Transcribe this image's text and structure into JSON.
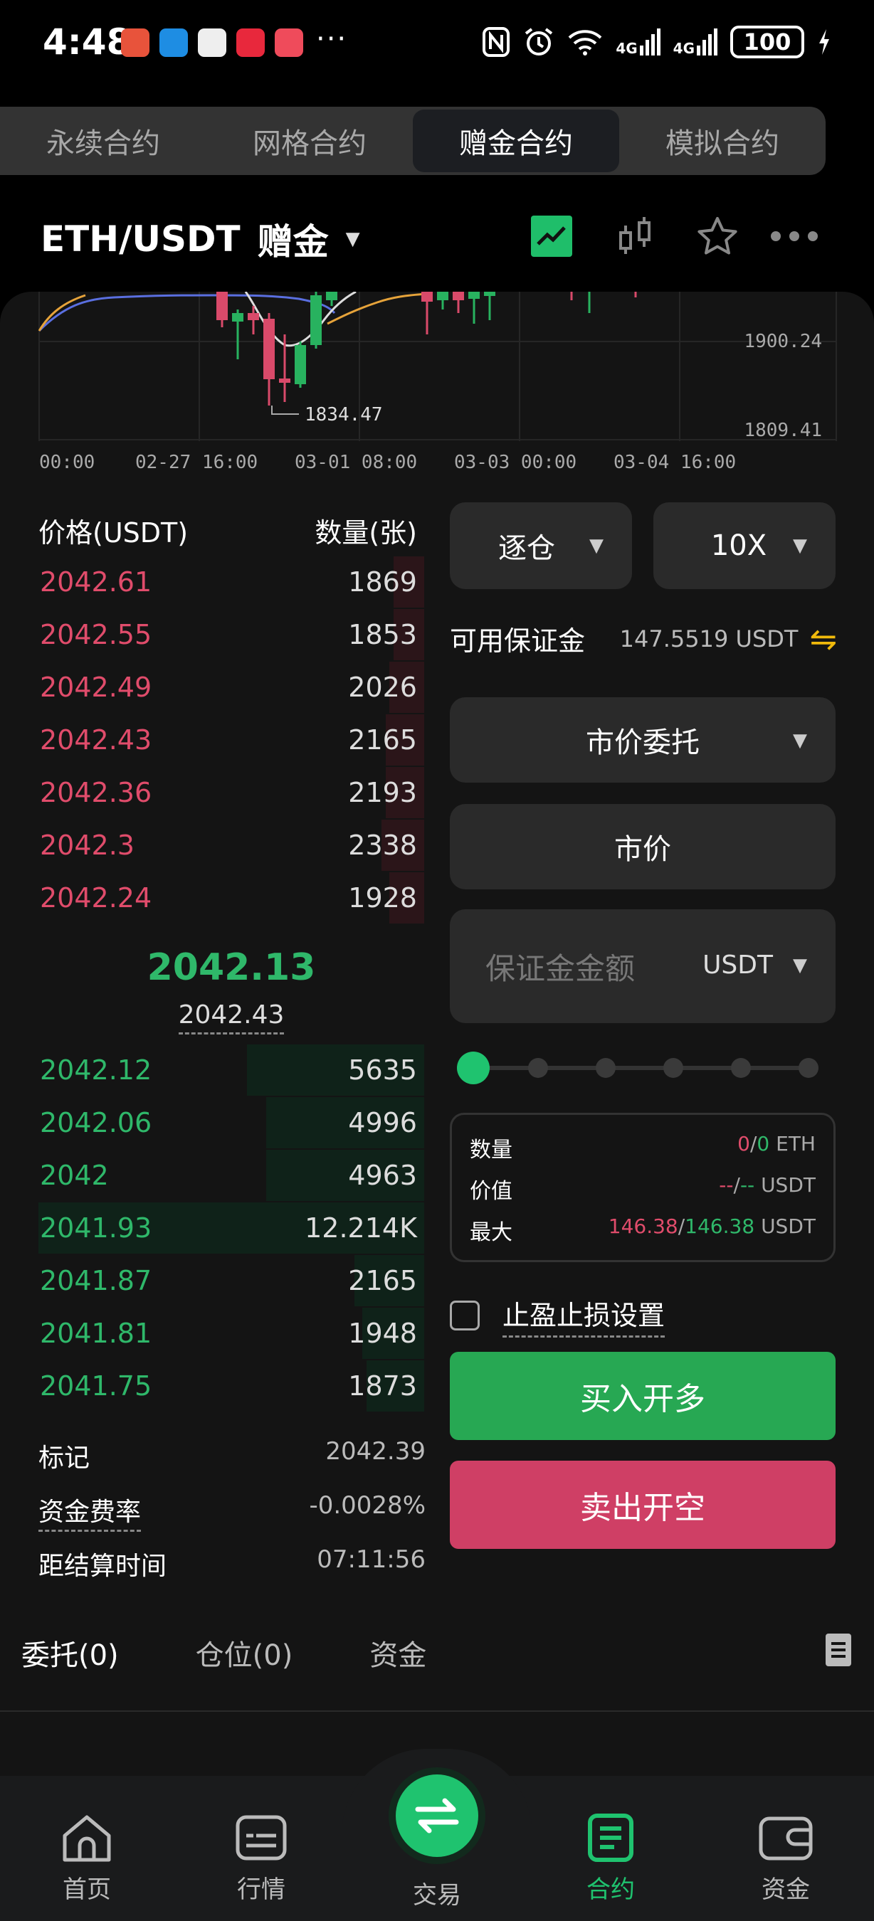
{
  "status_bar": {
    "time": "4:48",
    "dots": "···",
    "battery": "100",
    "network_1": "4G",
    "network_2": "4G"
  },
  "tabs": [
    {
      "label": "永续合约",
      "active": false
    },
    {
      "label": "网格合约",
      "active": false
    },
    {
      "label": "赠金合约",
      "active": true
    },
    {
      "label": "模拟合约",
      "active": false
    }
  ],
  "header": {
    "pair": "ETH/USDT",
    "mode": "赠金"
  },
  "mini_chart": {
    "price_levels": [
      "1900.24",
      "1809.41"
    ],
    "low_label": "1834.47",
    "time_labels": [
      "00:00",
      "02-27 16:00",
      "03-01 08:00",
      "03-03 00:00",
      "03-04 16:00"
    ]
  },
  "order_book": {
    "price_header": "价格(USDT)",
    "qty_header": "数量(张)",
    "asks": [
      {
        "price": "2042.61",
        "qty": "1869",
        "depth": 0.08
      },
      {
        "price": "2042.55",
        "qty": "1853",
        "depth": 0.08
      },
      {
        "price": "2042.49",
        "qty": "2026",
        "depth": 0.09
      },
      {
        "price": "2042.43",
        "qty": "2165",
        "depth": 0.1
      },
      {
        "price": "2042.36",
        "qty": "2193",
        "depth": 0.1
      },
      {
        "price": "2042.3",
        "qty": "2338",
        "depth": 0.11
      },
      {
        "price": "2042.24",
        "qty": "1928",
        "depth": 0.09
      }
    ],
    "last_price": "2042.13",
    "mark_price": "2042.43",
    "bids": [
      {
        "price": "2042.12",
        "qty": "5635",
        "depth": 0.46
      },
      {
        "price": "2042.06",
        "qty": "4996",
        "depth": 0.41
      },
      {
        "price": "2042",
        "qty": "4963",
        "depth": 0.41
      },
      {
        "price": "2041.93",
        "qty": "12.214K",
        "depth": 1.0
      },
      {
        "price": "2041.87",
        "qty": "2165",
        "depth": 0.18
      },
      {
        "price": "2041.81",
        "qty": "1948",
        "depth": 0.16
      },
      {
        "price": "2041.75",
        "qty": "1873",
        "depth": 0.15
      }
    ]
  },
  "info": {
    "mark_label": "标记",
    "mark_value": "2042.39",
    "funding_label": "资金费率",
    "funding_value": "-0.0028%",
    "settle_label": "距结算时间",
    "settle_value": "07:11:56"
  },
  "form": {
    "margin_mode": "逐仓",
    "leverage": "10X",
    "available_label": "可用保证金",
    "available_value": "147.5519 USDT",
    "order_type": "市价委托",
    "price_field": "市价",
    "amount_placeholder": "保证金金额",
    "amount_unit": "USDT",
    "slider_value": 0,
    "summary": {
      "qty_label": "数量",
      "qty_a": "0",
      "qty_sep": "/",
      "qty_b": "0",
      "qty_unit": "ETH",
      "value_label": "价值",
      "value_a": "--",
      "value_sep": "/",
      "value_b": "--",
      "value_unit": "USDT",
      "max_label": "最大",
      "max_a": "146.38",
      "max_sep": "/",
      "max_b": "146.38",
      "max_unit": "USDT"
    },
    "tpsl_label": "止盈止损设置",
    "buy_label": "买入开多",
    "sell_label": "卖出开空"
  },
  "bottom_tabs": [
    {
      "label": "委托(0)",
      "active": true
    },
    {
      "label": "仓位(0)",
      "active": false
    },
    {
      "label": "资金",
      "active": false
    }
  ],
  "nav": {
    "home": "首页",
    "market": "行情",
    "trade": "交易",
    "contract": "合约",
    "assets": "资金"
  },
  "colors": {
    "green": "#2fb86a",
    "red": "#e04c6b",
    "accent": "#1fc36f",
    "gold": "#f0b90b"
  }
}
